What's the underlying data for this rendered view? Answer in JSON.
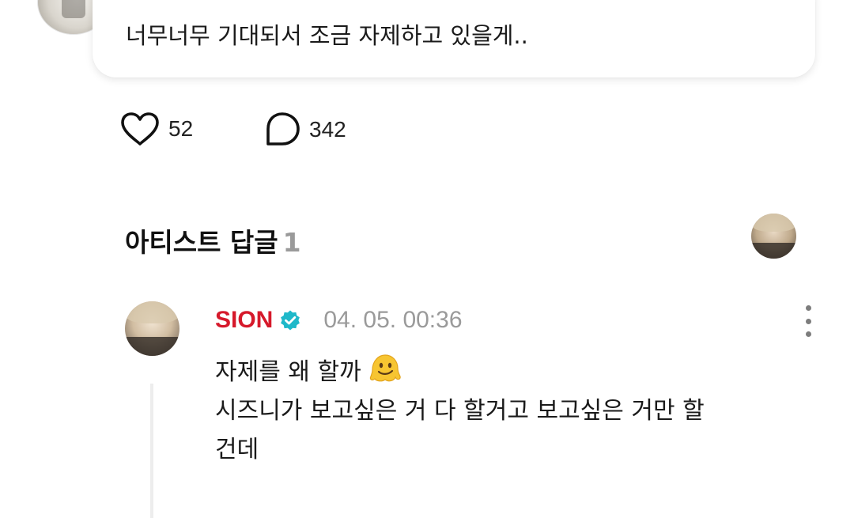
{
  "post": {
    "text": "너무너무 기대되서 조금 자제하고 있을게.."
  },
  "reactions": {
    "likes": "52",
    "comments": "342"
  },
  "artist_replies": {
    "title": "아티스트 답글",
    "count": "1"
  },
  "reply": {
    "author": "SION",
    "timestamp": "04. 05. 00:36",
    "lines": [
      "자제를 왜 할까",
      "시즈니가 보고싶은 거 다 할거고 보고싶은 거만 할",
      "건데"
    ],
    "emoji": "melting-face-emoji"
  },
  "colors": {
    "author_name": "#d6192b",
    "verified_badge": "#1fb8c9",
    "muted_text": "#9a9a9a",
    "thread_line": "#ededed"
  },
  "icons": [
    "heart-icon",
    "comment-icon",
    "verified-icon",
    "more-vertical-icon"
  ]
}
